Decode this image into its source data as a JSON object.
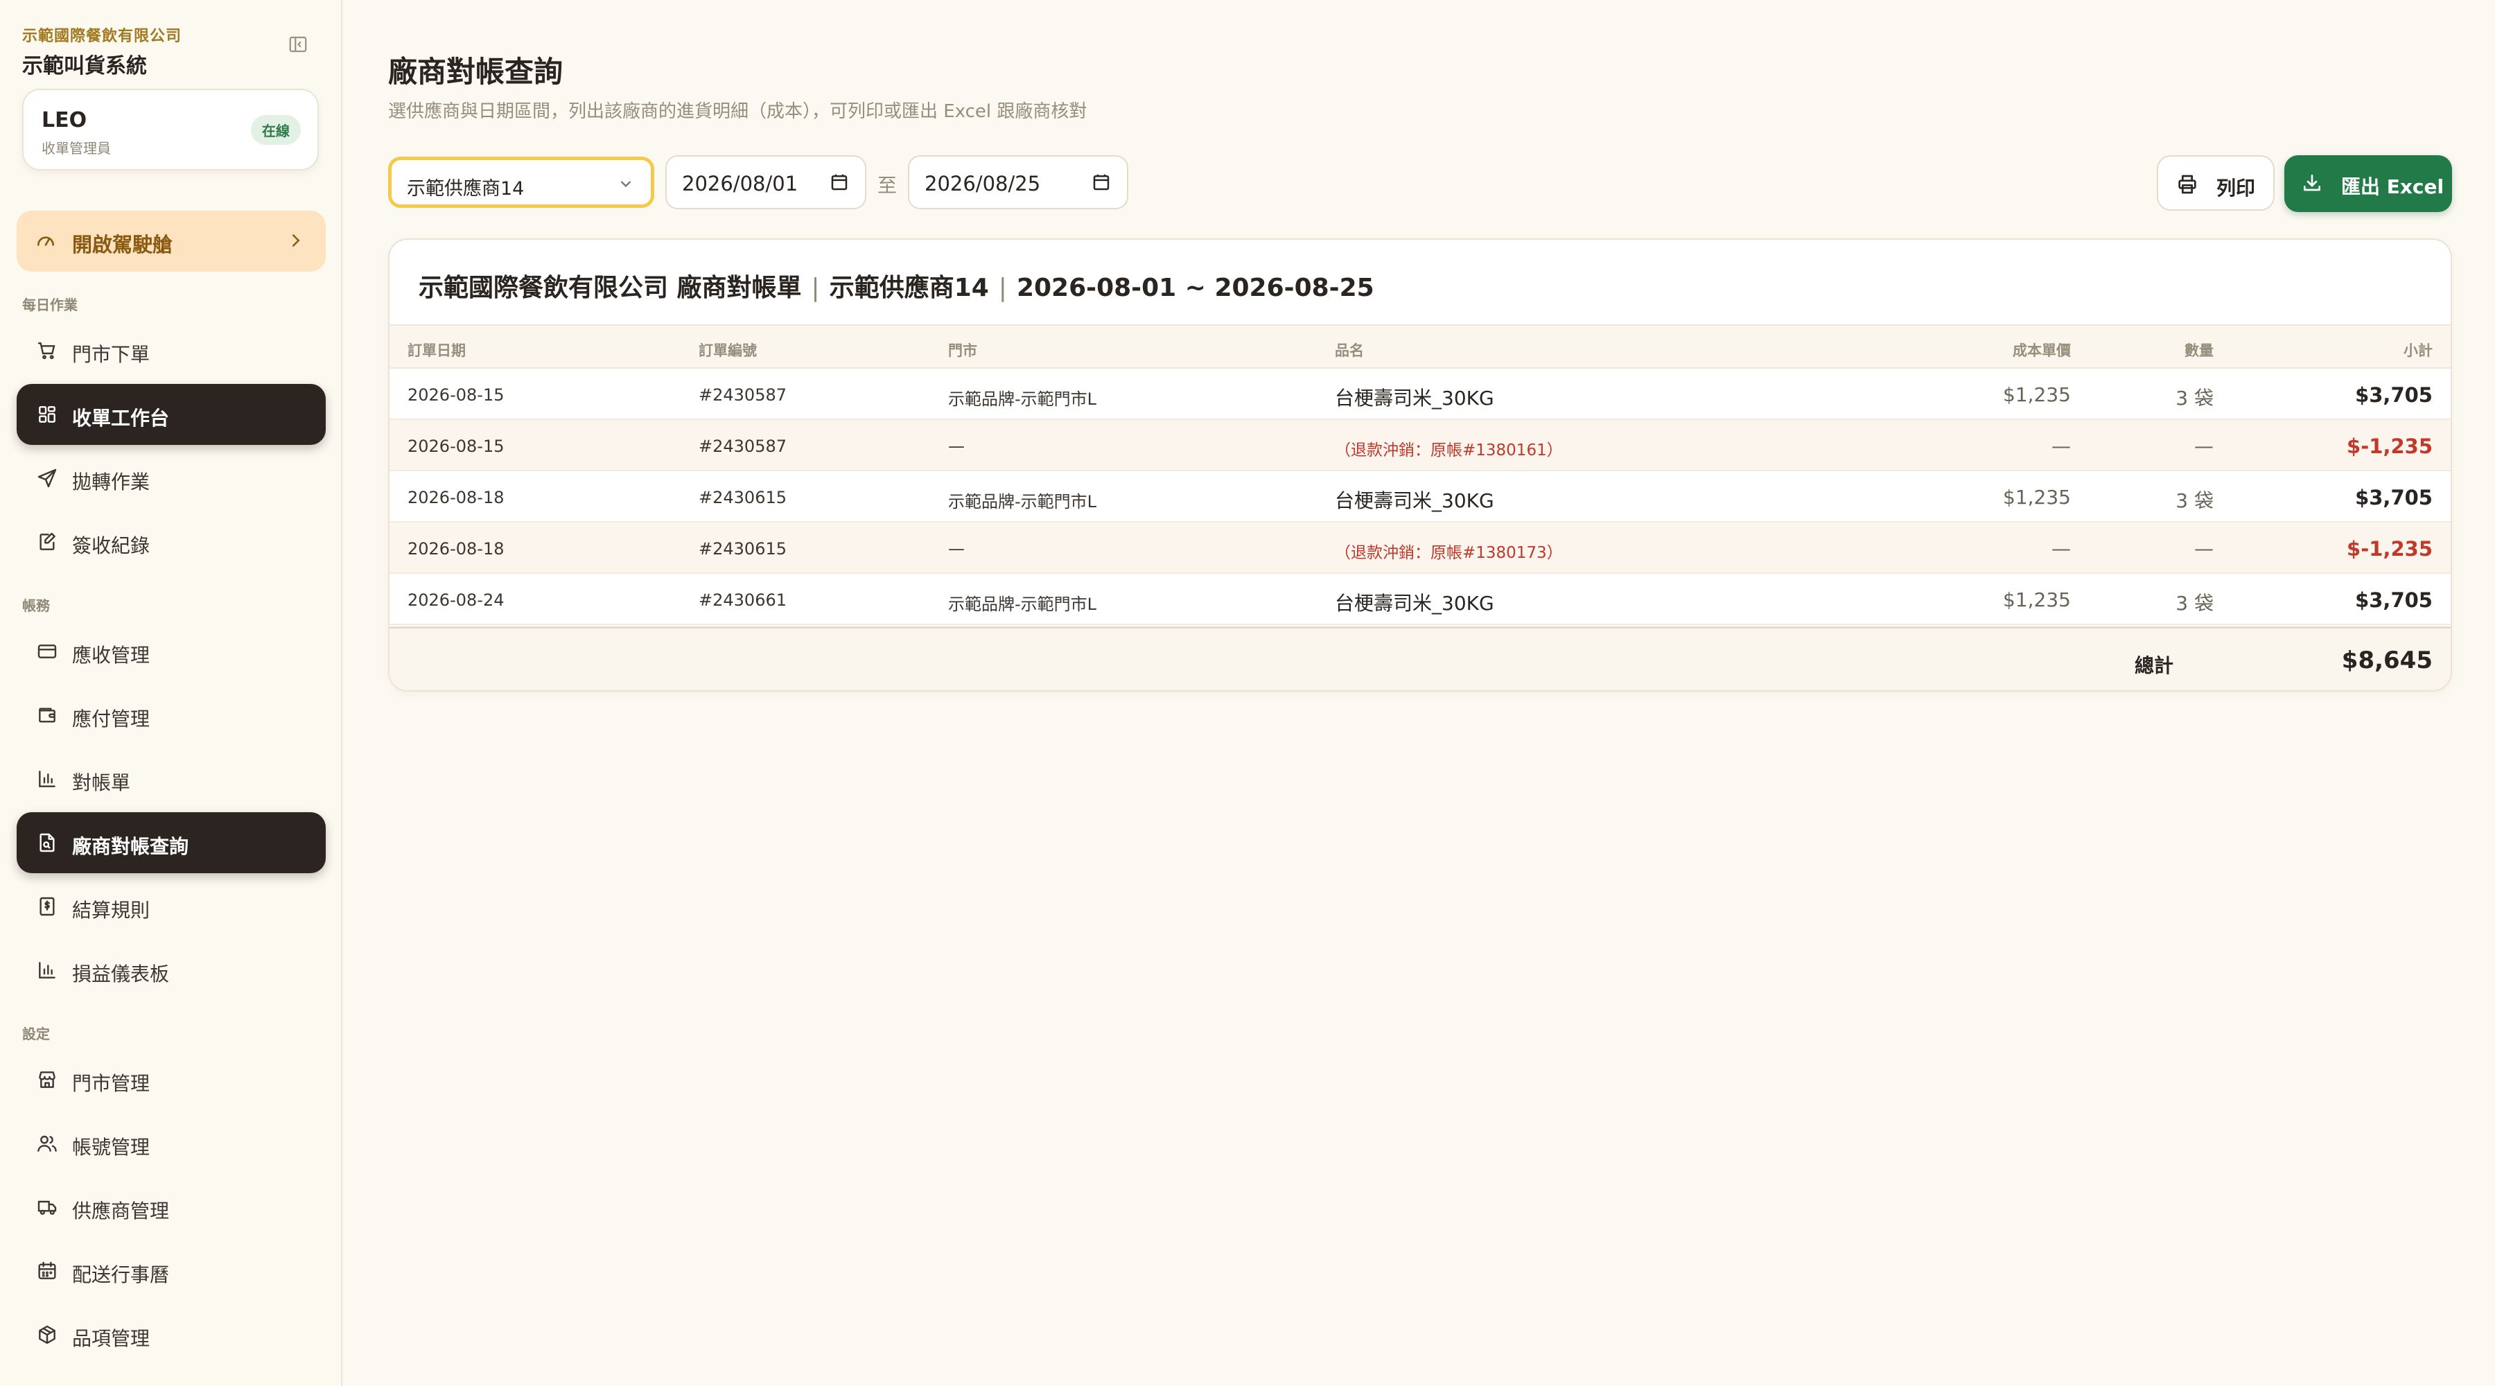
{
  "sidebar": {
    "company": "示範國際餐飲有限公司",
    "system_name": "示範叫貨系統",
    "user": {
      "name": "LEO",
      "role": "收單管理員",
      "status": "在線"
    },
    "tour_label": "開啟駕駛艙",
    "sections": [
      {
        "title": "每日作業",
        "items": [
          "門市下單",
          "收單工作台",
          "拋轉作業",
          "簽收紀錄"
        ]
      },
      {
        "title": "帳務",
        "items": [
          "應收管理",
          "應付管理",
          "對帳單",
          "廠商對帳查詢",
          "結算規則",
          "損益儀表板"
        ]
      },
      {
        "title": "設定",
        "items": [
          "門市管理",
          "帳號管理",
          "供應商管理",
          "配送行事曆",
          "品項管理"
        ]
      }
    ]
  },
  "header": {
    "title": "廠商對帳查詢",
    "subtitle": "選供應商與日期區間，列出該廠商的進貨明細（成本），可列印或匯出 Excel 跟廠商核對"
  },
  "filters": {
    "supplier": "示範供應商14",
    "date_from": "2026/08/01",
    "date_to": "2026/08/25",
    "range_sep": "至"
  },
  "actions": {
    "print_label": "列印",
    "export_label": "匯出 Excel"
  },
  "report": {
    "company": "示範國際餐飲有限公司 廠商對帳單",
    "supplier": "示範供應商14",
    "period": "2026-08-01 ~ 2026-08-25",
    "columns": {
      "date": "訂單日期",
      "order_no": "訂單編號",
      "store": "門市",
      "item": "品名",
      "unit_cost": "成本單價",
      "qty": "數量",
      "subtotal": "小計"
    },
    "rows": [
      {
        "date": "2026-08-15",
        "order_no": "#2430587",
        "store": "示範品牌-示範門市L",
        "item": "台梗壽司米_30KG",
        "note": "",
        "unit_cost": "$1,235",
        "qty": "3 袋",
        "subtotal": "$3,705",
        "refund": false
      },
      {
        "date": "2026-08-15",
        "order_no": "#2430587",
        "store": "—",
        "item": "",
        "note": "（退款沖銷：原帳#1380161）",
        "unit_cost": "—",
        "qty": "—",
        "subtotal": "$-1,235",
        "refund": true
      },
      {
        "date": "2026-08-18",
        "order_no": "#2430615",
        "store": "示範品牌-示範門市L",
        "item": "台梗壽司米_30KG",
        "note": "",
        "unit_cost": "$1,235",
        "qty": "3 袋",
        "subtotal": "$3,705",
        "refund": false
      },
      {
        "date": "2026-08-18",
        "order_no": "#2430615",
        "store": "—",
        "item": "",
        "note": "（退款沖銷：原帳#1380173）",
        "unit_cost": "—",
        "qty": "—",
        "subtotal": "$-1,235",
        "refund": true
      },
      {
        "date": "2026-08-24",
        "order_no": "#2430661",
        "store": "示範品牌-示範門市L",
        "item": "台梗壽司米_30KG",
        "note": "",
        "unit_cost": "$1,235",
        "qty": "3 袋",
        "subtotal": "$3,705",
        "refund": false
      }
    ],
    "total_label": "總計",
    "total_value": "$8,645"
  },
  "colors": {
    "accent_green": "#217a47",
    "refund_red": "#c0392b",
    "select_focus": "#f7c94a",
    "active_nav": "#2c2420"
  },
  "active_nav": [
    "收單工作台",
    "廠商對帳查詢"
  ]
}
